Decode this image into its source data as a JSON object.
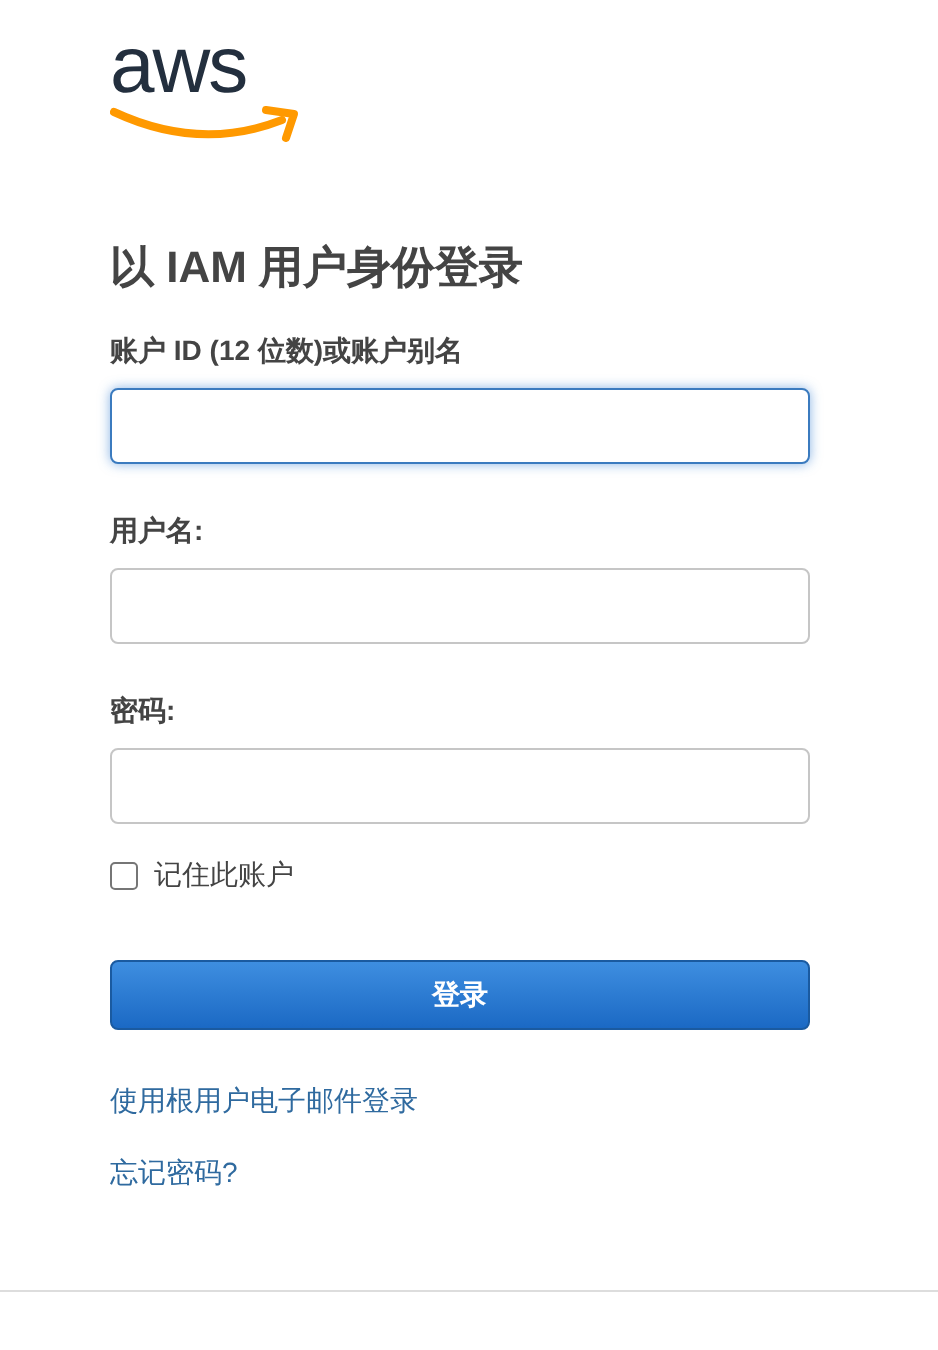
{
  "logo": {
    "text": "aws"
  },
  "title": "以 IAM 用户身份登录",
  "fields": [
    {
      "label": "账户 ID (12 位数)或账户别名",
      "focused": true
    },
    {
      "label": "用户名:",
      "focused": false
    },
    {
      "label": "密码:",
      "focused": false
    }
  ],
  "remember": {
    "label": "记住此账户",
    "checked": false
  },
  "submit": "登录",
  "links": [
    "使用根用户电子邮件登录",
    "忘记密码?"
  ]
}
